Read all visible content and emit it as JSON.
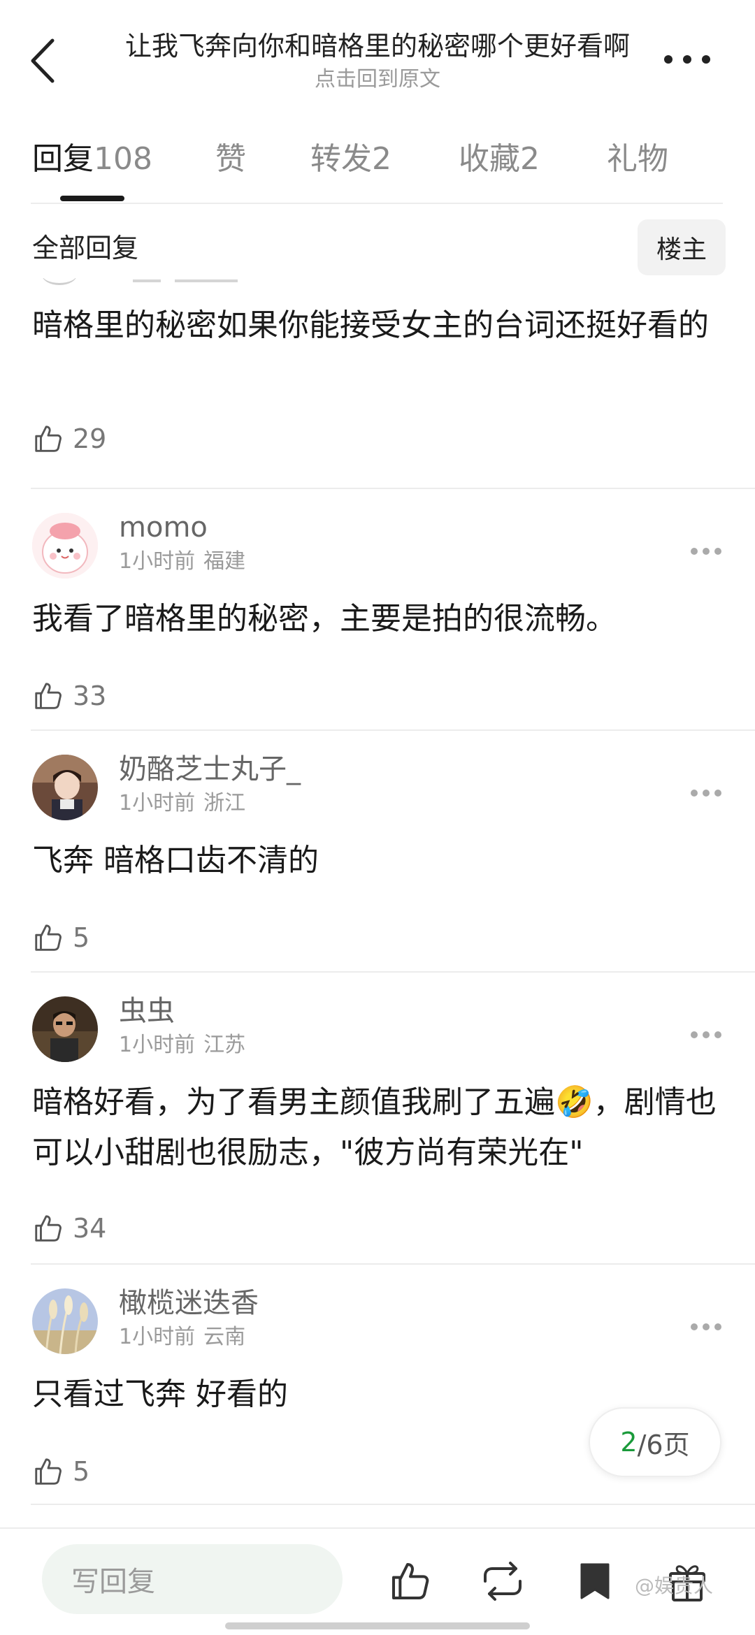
{
  "header": {
    "title": "让我飞奔向你和暗格里的秘密哪个更好看啊",
    "subtitle": "点击回到原文"
  },
  "tabs": [
    {
      "label": "回复",
      "count": "108"
    },
    {
      "label": "赞",
      "count": ""
    },
    {
      "label": "转发",
      "count": "2"
    },
    {
      "label": "收藏",
      "count": "2"
    },
    {
      "label": "礼物",
      "count": ""
    }
  ],
  "filter": {
    "label": "全部回复",
    "owner_button": "楼主"
  },
  "comments": [
    {
      "content": "暗格里的秘密如果你能接受女主的台词还挺好看的",
      "likes": "29"
    },
    {
      "username": "momo",
      "time": "1小时前",
      "location": "福建",
      "content": "我看了暗格里的秘密，主要是拍的很流畅。",
      "likes": "33",
      "avatar": "pink-cartoon-avatar"
    },
    {
      "username": "奶酪芝士丸子_",
      "time": "1小时前",
      "location": "浙江",
      "content": "飞奔 暗格口齿不清的",
      "likes": "5",
      "avatar": "photo-avatar-girl"
    },
    {
      "username": "虫虫",
      "time": "1小时前",
      "location": "江苏",
      "content": "暗格好看，为了看男主颜值我刷了五遍🤣，剧情也可以小甜剧也很励志，\"彼方尚有荣光在\"",
      "likes": "34",
      "avatar": "photo-avatar-man"
    },
    {
      "username": "橄榄迷迭香",
      "time": "1小时前",
      "location": "云南",
      "content": "只看过飞奔 好看的",
      "likes": "5",
      "avatar": "photo-avatar-plants"
    }
  ],
  "pagination": {
    "current": "2",
    "total_text": "/6页"
  },
  "bottom_bar": {
    "reply_placeholder": "写回复"
  },
  "watermark": "@娱贵人",
  "colors": {
    "accent_green": "#1a9a3a",
    "text_primary": "#1a1a1a",
    "text_secondary": "#9a9a9a"
  }
}
